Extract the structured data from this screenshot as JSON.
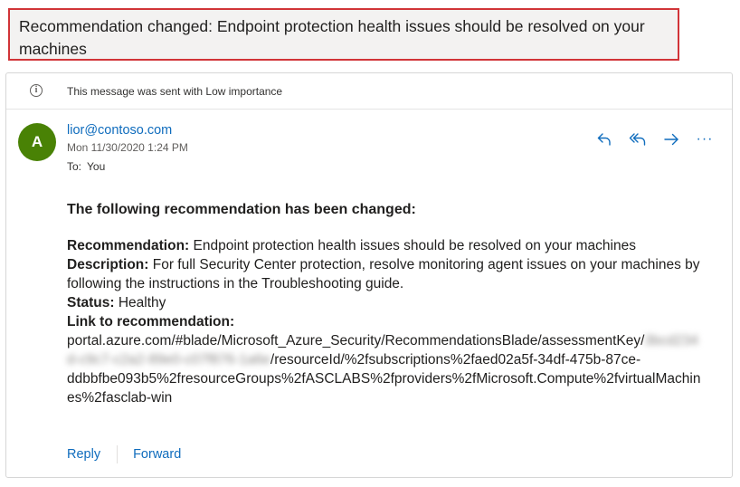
{
  "subject": "Recommendation changed: Endpoint protection health issues should be resolved on your machines",
  "importance_notice": "This message was sent with Low importance",
  "info_icon_glyph": "i",
  "sender": {
    "avatar_initial": "A",
    "avatar_color": "#498205",
    "email": "lior@contoso.com",
    "date": "Mon 11/30/2020 1:24 PM",
    "to_label": "To:",
    "to_value": "You"
  },
  "header_actions": {
    "reply_icon": "reply-icon",
    "reply_all_icon": "reply-all-icon",
    "forward_icon": "forward-icon",
    "more_label": "···"
  },
  "body": {
    "heading": "The following recommendation has been changed:",
    "recommendation_label": "Recommendation:",
    "recommendation_value": "Endpoint protection health issues should be resolved on your machines",
    "description_label": "Description:",
    "description_value": "For full Security Center protection, resolve monitoring agent issues on your machines by following the instructions in the Troubleshooting guide.",
    "status_label": "Status:",
    "status_value": "Healthy",
    "link_label": "Link to recommendation:",
    "link_line1": "portal.azure.com/#blade/Microsoft_Azure_Security/RecommendationsBlade/assessmentKey/",
    "link_blurred_a": "3bcd234",
    "link_blurred_b": "d-c9c7-c2a2-89e0-c07f876-1a6e",
    "link_line2_rest": "/resourceId/%2fsubscriptions%2faed02a5f-34df-475b-87ce-",
    "link_line3": "ddbbfbe093b5%2fresourceGroups%2fASCLABS%2fproviders%2fMicrosoft.Compute%2fvirtualMachin",
    "link_line4": "es%2fasclab-win"
  },
  "footer_actions": {
    "reply_label": "Reply",
    "forward_label": "Forward"
  },
  "colors": {
    "accent": "#0f6cbd",
    "highlight_border": "#d13438"
  }
}
